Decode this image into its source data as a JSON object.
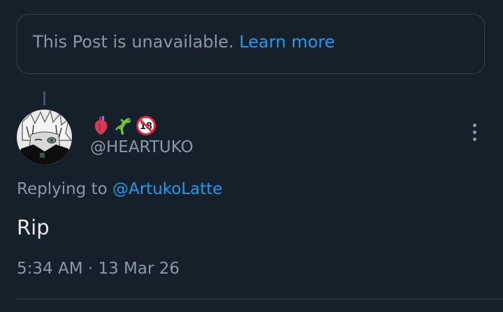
{
  "unavailable_notice": {
    "text": "This Post is unavailable.",
    "link_label": "Learn more"
  },
  "post": {
    "display_name_emojis": [
      "anatomical-heart",
      "lizard",
      "no-one-under-eighteen"
    ],
    "handle": "@HEARTUKO",
    "replying_prefix": "Replying to",
    "replying_to": "@ArtukoLatte",
    "text": "Rip",
    "timestamp": "5:34 AM · 13 Mar 26"
  },
  "colors": {
    "background": "#15202b",
    "border": "#38444d",
    "secondary_text": "#8b98a5",
    "primary_text": "#e7e9ea",
    "link": "#1d9bf0"
  }
}
